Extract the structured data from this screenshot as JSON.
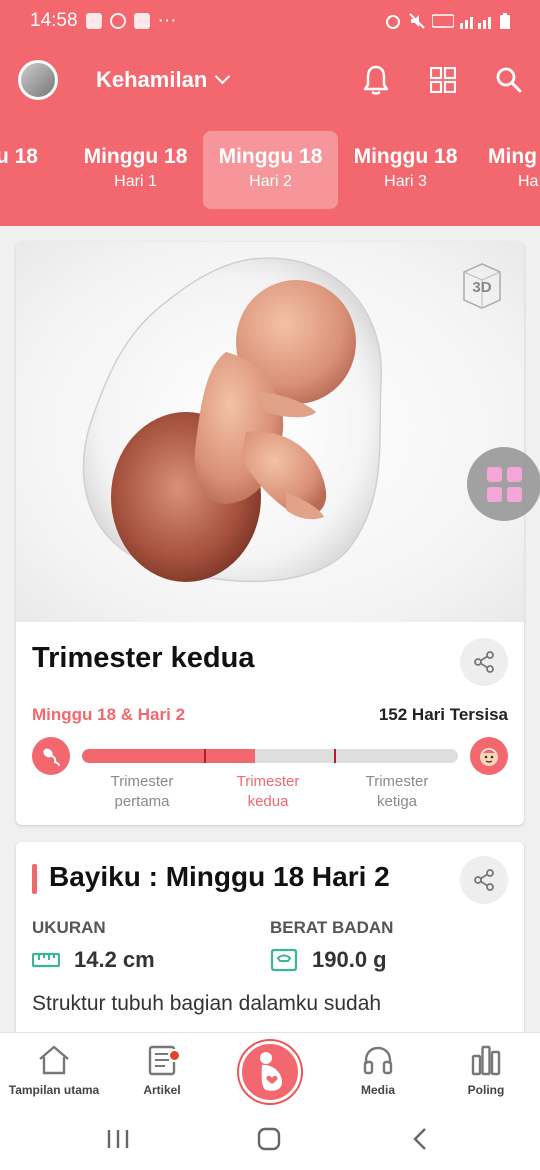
{
  "status": {
    "time": "14:58",
    "more": "···"
  },
  "header": {
    "title": "Kehamilan"
  },
  "week_tabs": [
    {
      "week": "gu 18",
      "day": ""
    },
    {
      "week": "Minggu 18",
      "day": "Hari 1"
    },
    {
      "week": "Minggu 18",
      "day": "Hari 2"
    },
    {
      "week": "Minggu 18",
      "day": "Hari 3"
    },
    {
      "week": "Ming",
      "day": "Ha"
    }
  ],
  "hero": {
    "badge": "3D"
  },
  "trimester_card": {
    "title": "Trimester kedua",
    "week_text": "Minggu 18 & Hari 2",
    "days_left": "152 Hari Tersisa",
    "progress_fraction": 0.46,
    "trimester_marks": [
      0.325,
      0.67
    ],
    "labels": [
      "Trimester pertama",
      "Trimester kedua",
      "Trimester ketiga"
    ],
    "current_index": 1
  },
  "baby_card": {
    "title": "Bayiku : Minggu 18 Hari 2",
    "size_label": "UKURAN",
    "size_value": "14.2 cm",
    "weight_label": "BERAT BADAN",
    "weight_value": "190.0 g",
    "description": "Struktur tubuh bagian dalamku sudah"
  },
  "bottom_nav": {
    "home": "Tampilan utama",
    "articles": "Artikel",
    "media": "Media",
    "poll": "Poling"
  },
  "colors": {
    "accent": "#f3686f",
    "accent_dark": "#b01f2a"
  }
}
